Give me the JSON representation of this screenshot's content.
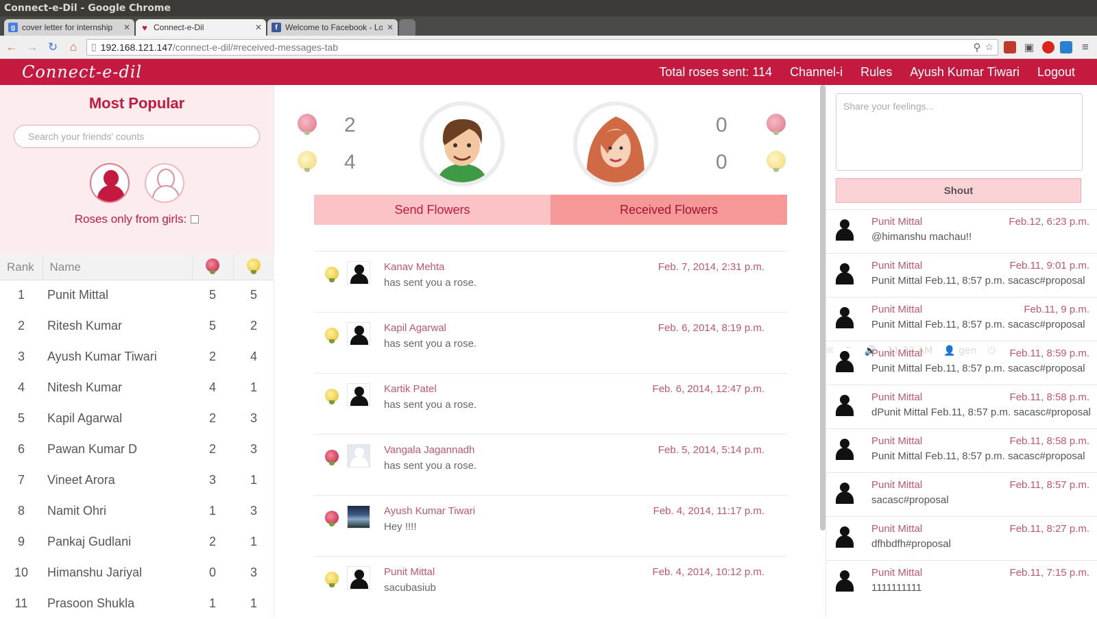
{
  "system": {
    "window_title": "Connect-e-Dil - Google Chrome",
    "time": "11:13 AM",
    "user": "gen"
  },
  "browser": {
    "tabs": [
      {
        "label": "cover letter for internship",
        "favicon": "G",
        "color": "#4a7fe0"
      },
      {
        "label": "Connect-e-Dil",
        "favicon": "heart",
        "color": "#c41a40"
      },
      {
        "label": "Welcome to Facebook - Lo",
        "favicon": "f",
        "color": "#3b5998"
      }
    ],
    "url_host": "192.168.121.147",
    "url_path": "/connect-e-dil/#received-messages-tab"
  },
  "nav": {
    "logo": "Connect-e-dil",
    "total_roses": "Total roses sent: 114",
    "channel": "Channel-i",
    "rules": "Rules",
    "user": "Ayush Kumar Tiwari",
    "logout": "Logout"
  },
  "popular": {
    "title": "Most Popular",
    "search_placeholder": "Search your friends' counts",
    "girls_filter": "Roses only from girls:",
    "headers": {
      "rank": "Rank",
      "name": "Name"
    },
    "rows": [
      {
        "rank": "1",
        "name": "Punit Mittal",
        "red": "5",
        "yellow": "5"
      },
      {
        "rank": "2",
        "name": "Ritesh Kumar",
        "red": "5",
        "yellow": "2"
      },
      {
        "rank": "3",
        "name": "Ayush Kumar Tiwari",
        "red": "2",
        "yellow": "4"
      },
      {
        "rank": "4",
        "name": "Nitesh Kumar",
        "red": "4",
        "yellow": "1"
      },
      {
        "rank": "5",
        "name": "Kapil Agarwal",
        "red": "2",
        "yellow": "3"
      },
      {
        "rank": "6",
        "name": "Pawan Kumar D",
        "red": "2",
        "yellow": "3"
      },
      {
        "rank": "7",
        "name": "Vineet Arora",
        "red": "3",
        "yellow": "1"
      },
      {
        "rank": "8",
        "name": "Namit Ohri",
        "red": "1",
        "yellow": "3"
      },
      {
        "rank": "9",
        "name": "Pankaj Gudlani",
        "red": "2",
        "yellow": "1"
      },
      {
        "rank": "10",
        "name": "Himanshu Jariyal",
        "red": "0",
        "yellow": "3"
      },
      {
        "rank": "11",
        "name": "Prasoon Shukla",
        "red": "1",
        "yellow": "1"
      }
    ]
  },
  "stats": {
    "sent_red": "2",
    "sent_yellow": "4",
    "recv_red": "0",
    "recv_yellow": "0"
  },
  "flower_tabs": {
    "send": "Send Flowers",
    "received": "Received Flowers"
  },
  "messages": [
    {
      "rose": "yellow",
      "avatar": "silhouette",
      "name": "Kanav Mehta",
      "text": "has sent you a rose.",
      "date": "Feb. 7, 2014, 2:31 p.m."
    },
    {
      "rose": "yellow",
      "avatar": "silhouette",
      "name": "Kapil Agarwal",
      "text": "has sent you a rose.",
      "date": "Feb. 6, 2014, 8:19 p.m."
    },
    {
      "rose": "yellow",
      "avatar": "silhouette",
      "name": "Kartik Patel",
      "text": "has sent you a rose.",
      "date": "Feb. 6, 2014, 12:47 p.m."
    },
    {
      "rose": "red",
      "avatar": "blank",
      "name": "Vangala Jagannadh",
      "text": "has sent you a rose.",
      "date": "Feb. 5, 2014, 5:14 p.m."
    },
    {
      "rose": "red",
      "avatar": "photo",
      "name": "Ayush Kumar Tiwari",
      "text": "Hey !!!!",
      "date": "Feb. 4, 2014, 11:17 p.m."
    },
    {
      "rose": "yellow",
      "avatar": "silhouette",
      "name": "Punit Mittal",
      "text": "sacubasiub",
      "date": "Feb. 4, 2014, 10:12 p.m."
    }
  ],
  "shout": {
    "placeholder": "Share your feelings...",
    "button": "Shout",
    "feed": [
      {
        "name": "Punit Mittal",
        "date": "Feb.12, 6:23 p.m.",
        "text": "@himanshu machau!!"
      },
      {
        "name": "Punit Mittal",
        "date": "Feb.11, 9:01 p.m.",
        "text": "Punit Mittal Feb.11, 8:57 p.m. sacasc#proposal"
      },
      {
        "name": "Punit Mittal",
        "date": "Feb.11, 9 p.m.",
        "text": "Punit Mittal Feb.11, 8:57 p.m. sacasc#proposal"
      },
      {
        "name": "Punit Mittal",
        "date": "Feb.11, 8:59 p.m.",
        "text": "Punit Mittal Feb.11, 8:57 p.m. sacasc#proposal"
      },
      {
        "name": "Punit Mittal",
        "date": "Feb.11, 8:58 p.m.",
        "text": "dPunit Mittal Feb.11, 8:57 p.m. sacasc#proposal"
      },
      {
        "name": "Punit Mittal",
        "date": "Feb.11, 8:58 p.m.",
        "text": "Punit Mittal Feb.11, 8:57 p.m. sacasc#proposal"
      },
      {
        "name": "Punit Mittal",
        "date": "Feb.11, 8:57 p.m.",
        "text": "sacasc#proposal"
      },
      {
        "name": "Punit Mittal",
        "date": "Feb.11, 8:27 p.m.",
        "text": "dfhbdfh#proposal"
      },
      {
        "name": "Punit Mittal",
        "date": "Feb.11, 7:15 p.m.",
        "text": "1111111111"
      }
    ]
  }
}
